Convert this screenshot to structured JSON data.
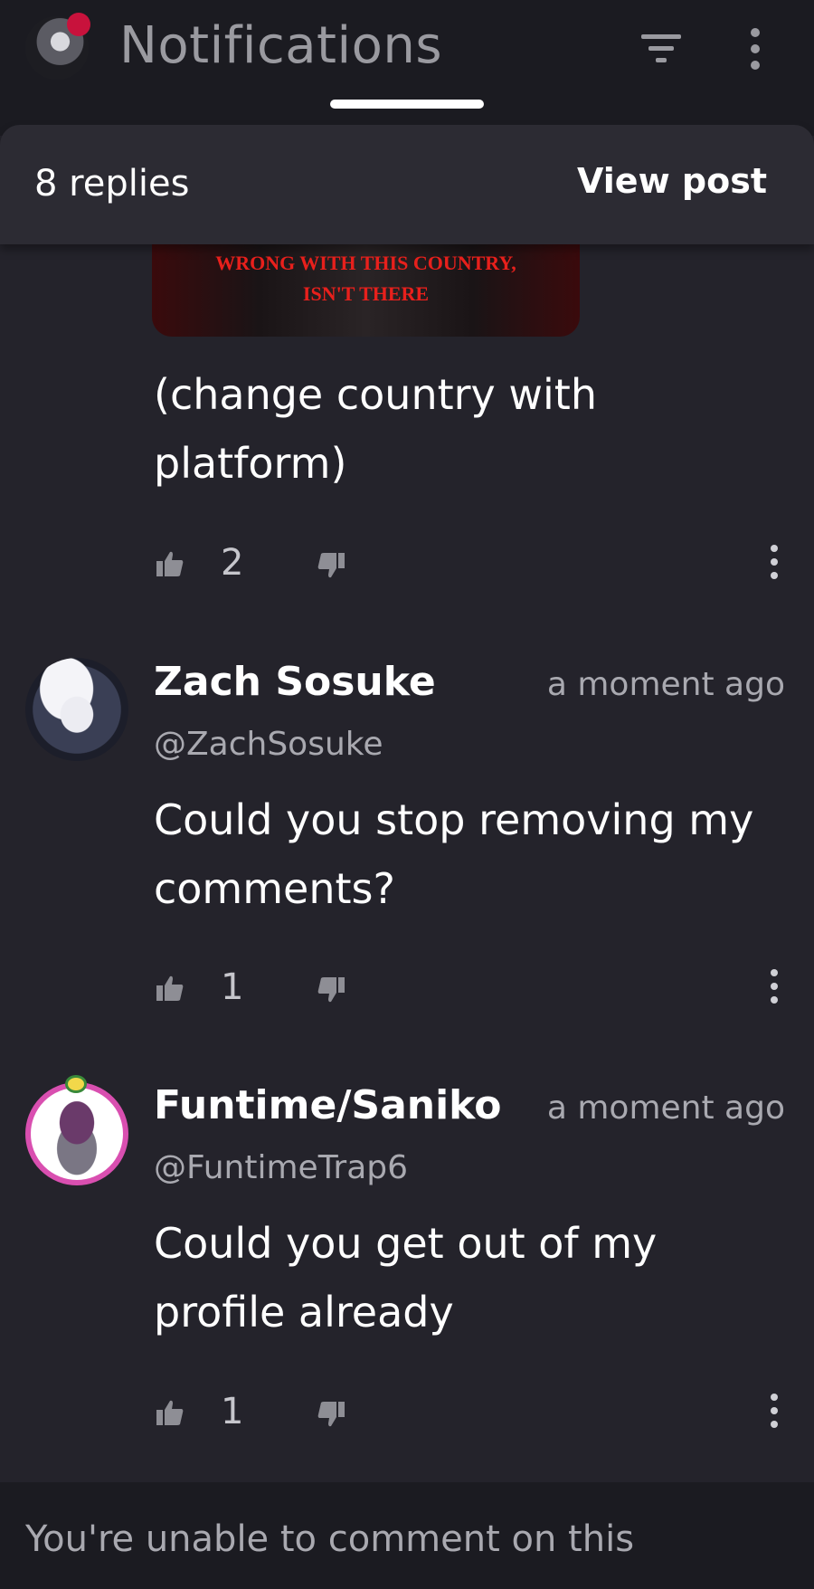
{
  "header": {
    "title": "Notifications",
    "avatar_icon": "user-avatar-icon",
    "notification_dot_color": "#c8123c",
    "filter_icon": "filter-icon",
    "more_icon": "more-vertical-icon"
  },
  "sheet": {
    "replies_label": "8 replies",
    "view_post_label": "View post"
  },
  "post_image": {
    "line1": "WRONG WITH THIS COUNTRY,",
    "line2": "ISN'T THERE"
  },
  "first_comment": {
    "text_line1": "(change country with",
    "text_line2": "platform)",
    "likes": "2"
  },
  "comments": [
    {
      "name": "Zach Sosuke",
      "time": "a moment ago",
      "handle": "@ZachSosuke",
      "text_line1": "Could you stop removing my",
      "text_line2": "comments?",
      "likes": "1"
    },
    {
      "name": "Funtime/Saniko",
      "time": "a moment ago",
      "handle": "@FuntimeTrap6",
      "text_line1": "Could you get out of my",
      "text_line2": "profile already",
      "likes": "1"
    }
  ],
  "footer": {
    "message": "You're unable to comment on this"
  }
}
